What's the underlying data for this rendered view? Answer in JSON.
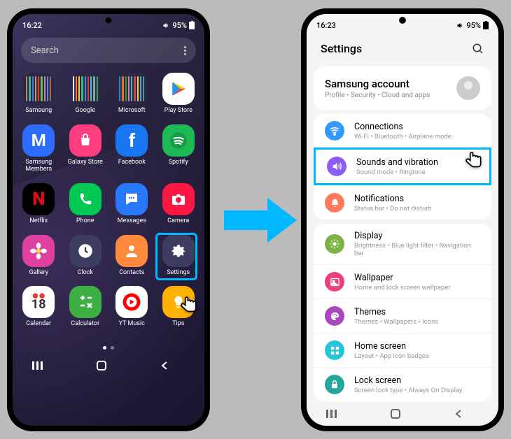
{
  "left": {
    "status": {
      "time": "16:22",
      "battery": "95%"
    },
    "search": {
      "placeholder": "Search"
    },
    "apps": [
      [
        {
          "name": "Samsung",
          "type": "folder",
          "minis": [
            "#b85",
            "#4a9",
            "#38c",
            "#e84",
            "#c44",
            "#6b4",
            "#c8a",
            "#58c",
            "#a64"
          ]
        },
        {
          "name": "Google",
          "type": "folder",
          "minis": [
            "#fff",
            "#e73",
            "#ec3",
            "#3b8",
            "#48d",
            "#e33",
            "#3cc",
            "#999",
            "#3a5"
          ]
        },
        {
          "name": "Microsoft",
          "type": "folder",
          "minis": [
            "#28c",
            "#e63",
            "#393",
            "#e7a",
            "#3bc",
            "#c43",
            "#fc3",
            "#69c",
            "#3a7"
          ]
        },
        {
          "name": "Play Store",
          "bg": "#fff",
          "glyph": "play"
        }
      ],
      [
        {
          "name": "Samsung Members",
          "bg": "#2e6cff",
          "glyph": "M"
        },
        {
          "name": "Galaxy Store",
          "bg": "#ff3d7f",
          "glyph": "bag"
        },
        {
          "name": "Facebook",
          "bg": "#1877f2",
          "glyph": "f"
        },
        {
          "name": "Spotify",
          "bg": "#1db954",
          "glyph": "spotify"
        }
      ],
      [
        {
          "name": "Netflix",
          "bg": "#000",
          "glyph": "N"
        },
        {
          "name": "Phone",
          "bg": "#00c853",
          "glyph": "phone"
        },
        {
          "name": "Messages",
          "bg": "#2979ff",
          "glyph": "msg"
        },
        {
          "name": "Camera",
          "bg": "#ff1744",
          "glyph": "cam"
        }
      ],
      [
        {
          "name": "Gallery",
          "bg": "#e040a0",
          "glyph": "flower"
        },
        {
          "name": "Clock",
          "bg": "#3d3d60",
          "glyph": "clock"
        },
        {
          "name": "Contacts",
          "bg": "#ff8a3d",
          "glyph": "person"
        },
        {
          "name": "Settings",
          "bg": "#3d3d60",
          "glyph": "gear",
          "hl": true
        }
      ],
      [
        {
          "name": "Calendar",
          "bg": "#fff",
          "glyph": "18"
        },
        {
          "name": "Calculator",
          "bg": "#3cb043",
          "glyph": "calc"
        },
        {
          "name": "YT Music",
          "bg": "#fff",
          "glyph": "yt"
        },
        {
          "name": "Tips",
          "bg": "#ffb300",
          "glyph": "bulb"
        }
      ]
    ]
  },
  "right": {
    "status": {
      "time": "16:23",
      "battery": "95%"
    },
    "header": "Settings",
    "account": {
      "title": "Samsung account",
      "sub": "Profile  •  Security  •  Cloud and apps"
    },
    "groups": [
      [
        {
          "id": "connections",
          "title": "Connections",
          "sub": "Wi-Fi  •  Bluetooth  •  Airplane mode",
          "color": "#3399ff",
          "icon": "wifi"
        },
        {
          "id": "sounds",
          "title": "Sounds and vibration",
          "sub": "Sound mode  •  Ringtone",
          "color": "#8b5cf6",
          "icon": "speaker",
          "hl": true
        },
        {
          "id": "notifications",
          "title": "Notifications",
          "sub": "Status bar  •  Do not disturb",
          "color": "#ff7a5c",
          "icon": "bell"
        }
      ],
      [
        {
          "id": "display",
          "title": "Display",
          "sub": "Brightness  •  Blue light filter  •  Navigation bar",
          "color": "#7cb342",
          "icon": "sun"
        },
        {
          "id": "wallpaper",
          "title": "Wallpaper",
          "sub": "Home and lock screen wallpaper",
          "color": "#ec407a",
          "icon": "image"
        },
        {
          "id": "themes",
          "title": "Themes",
          "sub": "Themes  •  Wallpapers  •  Icons",
          "color": "#ab47bc",
          "icon": "palette"
        },
        {
          "id": "homescreen",
          "title": "Home screen",
          "sub": "Layout  •  App icon badges",
          "color": "#26c6da",
          "icon": "grid"
        },
        {
          "id": "lockscreen",
          "title": "Lock screen",
          "sub": "Screen lock type  •  Always On Display",
          "color": "#26a69a",
          "icon": "lock"
        }
      ]
    ]
  },
  "arrow_color": "#00b8ff"
}
